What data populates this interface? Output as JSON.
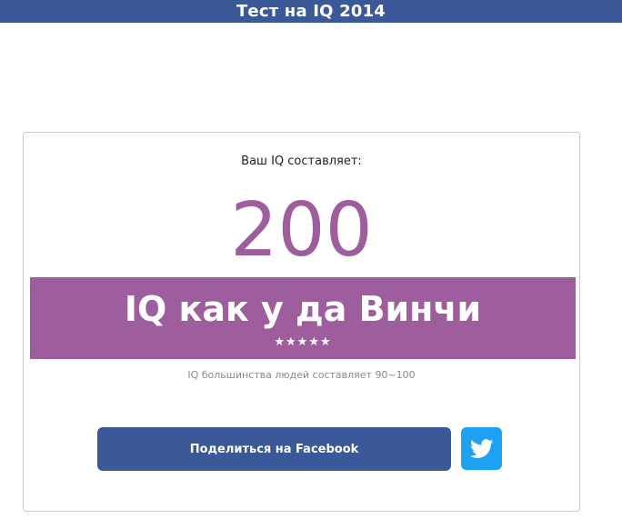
{
  "header": {
    "title": "Тест на IQ 2014"
  },
  "result": {
    "label": "Ваш IQ составляет:",
    "score": "200",
    "comparison": "IQ как у да Винчи",
    "stars": "★★★★★",
    "note": "IQ большинства людей составляет 90~100"
  },
  "share": {
    "facebook_label": "Поделиться на Facebook",
    "twitter_icon": "twitter-bird-icon"
  },
  "colors": {
    "header_bg": "#3b5998",
    "accent_purple": "#9e5e9e",
    "facebook_blue": "#3b5998",
    "twitter_blue": "#1da1f2"
  }
}
